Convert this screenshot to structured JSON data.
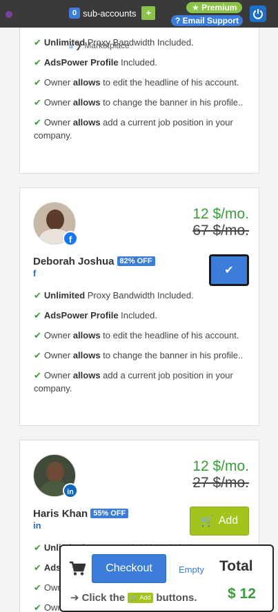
{
  "topbar": {
    "subaccounts_count": "0",
    "subaccounts_label": "sub-accounts",
    "plus": "+",
    "premium": "★ Premium",
    "email_support": "? Email Support"
  },
  "breadcrumb": {
    "label": "Marketplace",
    "home_glyph": "a",
    "arrow": "❯"
  },
  "feature_texts": {
    "f1_bold": "Unlimited",
    "f1_rest": " Proxy Bandwidth Included.",
    "f2_bold": "AdsPower Profile",
    "f2_rest": " Included.",
    "f3_pre": "Owner ",
    "f3_bold": "allows",
    "f3_rest": " to edit the headline of his account.",
    "f4_pre": "Owner ",
    "f4_bold": "allows",
    "f4_rest": " to change the banner in his profile..",
    "f5_pre": "Owner ",
    "f5_bold": "allows",
    "f5_rest": " add a current job position in your company."
  },
  "cards": [
    {
      "name": "Deborah Joshua",
      "discount": "82% OFF",
      "network": "f",
      "price_now": "12 $/mo.",
      "price_was": "67 $/mo."
    },
    {
      "name": "Haris Khan",
      "discount": "55% OFF",
      "network": "in",
      "price_now": "12 $/mo.",
      "price_was": "27 $/mo.",
      "add_label": "Add"
    }
  ],
  "cart": {
    "checkout": "Checkout",
    "empty": "Empty",
    "total_label": "Total",
    "hint_pre": "Click the",
    "hint_btn": "Add",
    "hint_post": "buttons.",
    "amount": "$ 12"
  },
  "colors": {
    "accent_blue": "#3b7dd8",
    "green": "#3a9b3a",
    "add_green": "#a3c41c"
  }
}
